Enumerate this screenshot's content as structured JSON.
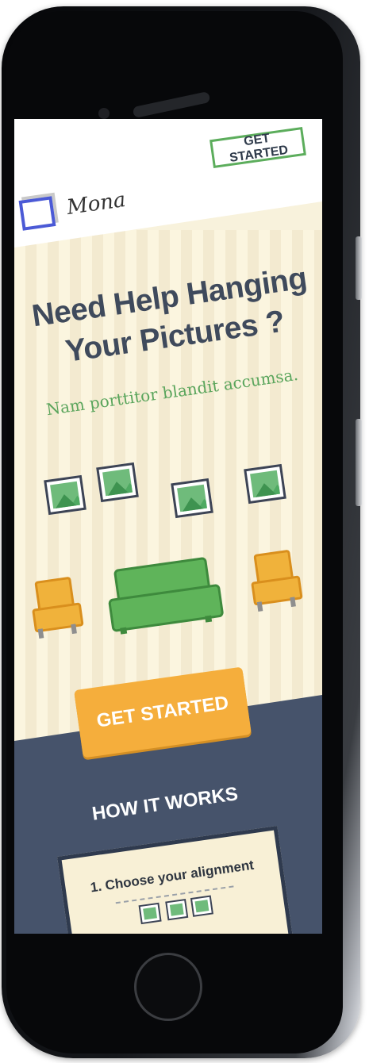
{
  "header": {
    "logo_text": "Mona",
    "get_started_label": "GET STARTED"
  },
  "hero": {
    "title": "Need Help Hanging Your Pictures ?",
    "subtitle": "Nam porttitor blandit accumsa."
  },
  "cta": {
    "label": "GET STARTED"
  },
  "how_it_works": {
    "heading": "HOW IT WORKS",
    "steps": [
      {
        "title": "1. Choose your alignment"
      }
    ]
  },
  "colors": {
    "accent_green": "#5cad5c",
    "cta_orange": "#f5ae3c",
    "floor_navy": "#46536b",
    "wall_cream": "#f8f2dc",
    "title_text": "#3f4a5c"
  },
  "icons": [
    "logo-mark-icon",
    "picture-frame-icon",
    "armchair-icon",
    "sofa-icon",
    "mini-frame-icon"
  ]
}
